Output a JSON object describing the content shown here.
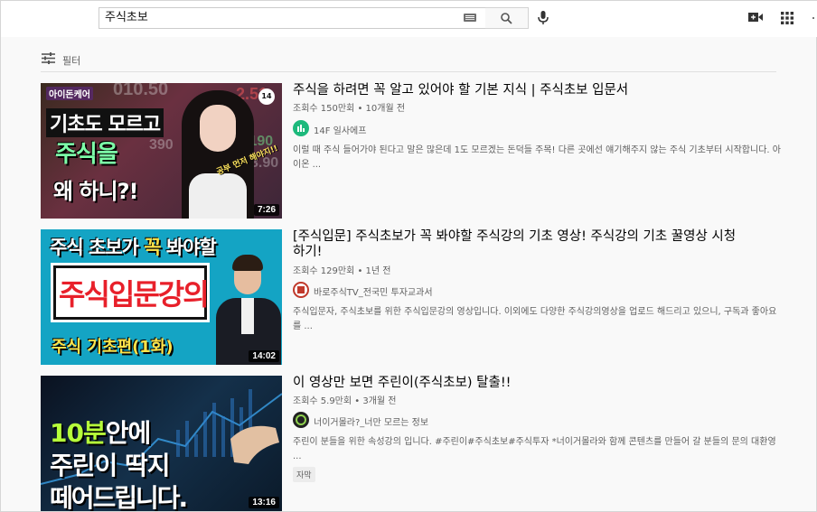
{
  "search": {
    "query": "주식초보"
  },
  "filter": {
    "label": "필터"
  },
  "results": [
    {
      "title": "주식을 하려면 꼭 알고 있어야 할 기본 지식 | 주식초보 입문서",
      "views": "조회수 150만회",
      "age": "10개월 전",
      "channel": "14F 일사에프",
      "channel_color": "#1db97c",
      "description": "이럴 때 주식 들어가야 된다고 말은 많은데 1도 모르겠는 돈덕들 주목! 다른 곳에선 얘기해주지 않는 주식 기초부터 시작합니다. 아이온 ...",
      "duration": "7:26",
      "thumb": {
        "brand": "아이돈케어",
        "line1": "기초도 모르고",
        "line2": "주식을",
        "line3": "왜 하니?!",
        "sticker": "공부 먼저 해야지!!",
        "logo": "14"
      }
    },
    {
      "title": "[주식입문] 주식초보가 꼭 봐야할 주식강의 기초 영상! 주식강의 기초 꿀영상 시청하기!",
      "views": "조회수 129만회",
      "age": "1년 전",
      "channel": "바로주식TV_전국민 투자교과서",
      "channel_color": "#c0392b",
      "description": "주식입문자, 주식초보를 위한 주식입문강의 영상입니다. 이외에도 다양한 주식강의영상을 업로드 해드리고 있으니, 구독과 좋아요를 ...",
      "duration": "14:02",
      "thumb": {
        "top_a": "주식 초보가 ",
        "top_hl": "꼭",
        "top_b": " 봐야할",
        "box": "주식입문강의",
        "bottom": "주식 기초편(1화)"
      }
    },
    {
      "title": "이 영상만 보면 주린이(주식초보) 탈출!!",
      "views": "조회수 5.9만회",
      "age": "3개월 전",
      "channel": "너이거몰라?_너만 모르는 정보",
      "channel_color": "#222222",
      "description": "주린이 분들을 위한 속성강의 입니다. #주린이#주식초보#주식투자 *너이거몰라와 함께 콘텐츠를 만들어 갈 분들의 문의 대환영 ...",
      "duration": "13:16",
      "badge": "자막",
      "thumb": {
        "l1_hl": "10분",
        "l1_b": "안에",
        "l2": "주린이 딱지",
        "l3": "떼어드립니다."
      }
    }
  ]
}
